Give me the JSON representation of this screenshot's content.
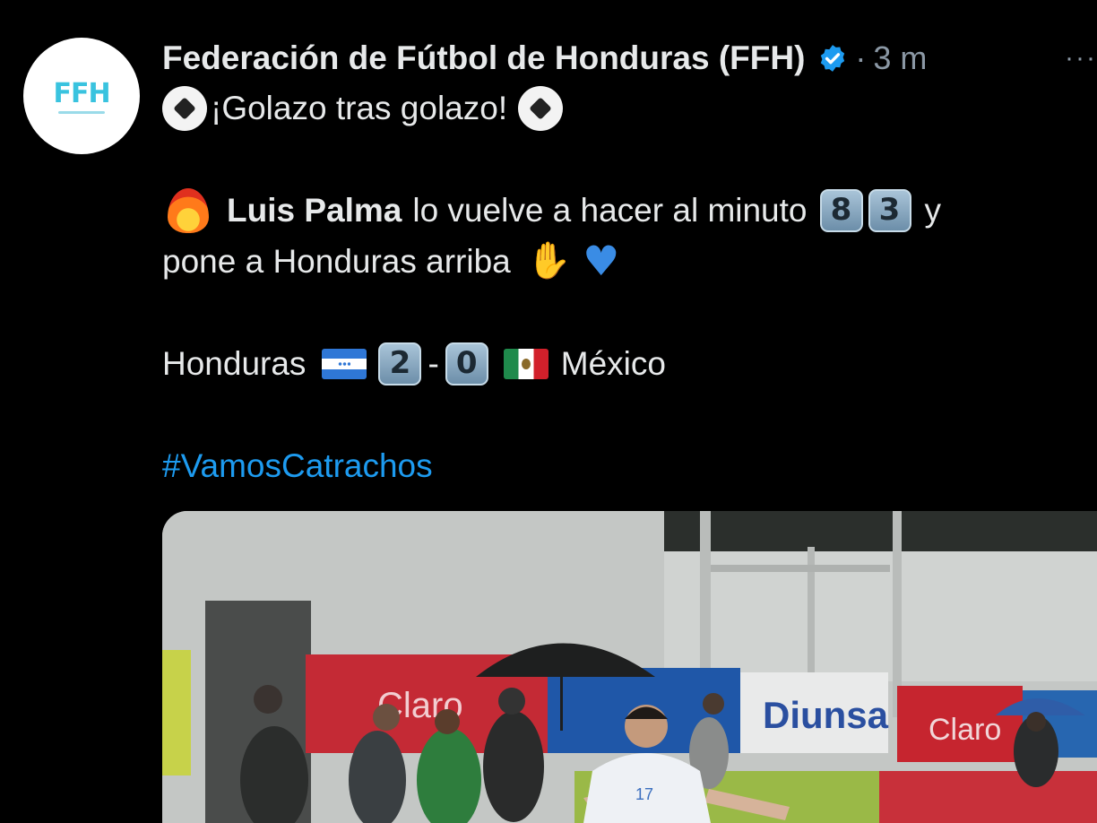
{
  "post": {
    "author_name": "Federación de Fútbol de Honduras (FFH)",
    "timestamp": "3 m",
    "timestamp_sep": "·",
    "more_label": "···",
    "avatar_text": "FFH",
    "lines": {
      "headline": "¡Golazo tras golazo!",
      "player": "Luis Palma",
      "text1": "lo vuelve a hacer al minuto",
      "minute_digits": [
        "8",
        "3"
      ],
      "text1_end": "y",
      "text2": "pone a Honduras arriba",
      "team_home": "Honduras",
      "score_home": "2",
      "score_sep": "-",
      "score_away": "0",
      "team_away": "México",
      "hashtag": "#VamosCatrachos"
    }
  },
  "media": {
    "ad_boards": [
      "Claro",
      "Diunsa",
      "Claro"
    ],
    "player_number": "17"
  },
  "colors": {
    "background": "#000000",
    "text": "#e7e9ea",
    "secondary": "#8b98a5",
    "link": "#1d9bf0",
    "verified": "#1d9bf0"
  }
}
